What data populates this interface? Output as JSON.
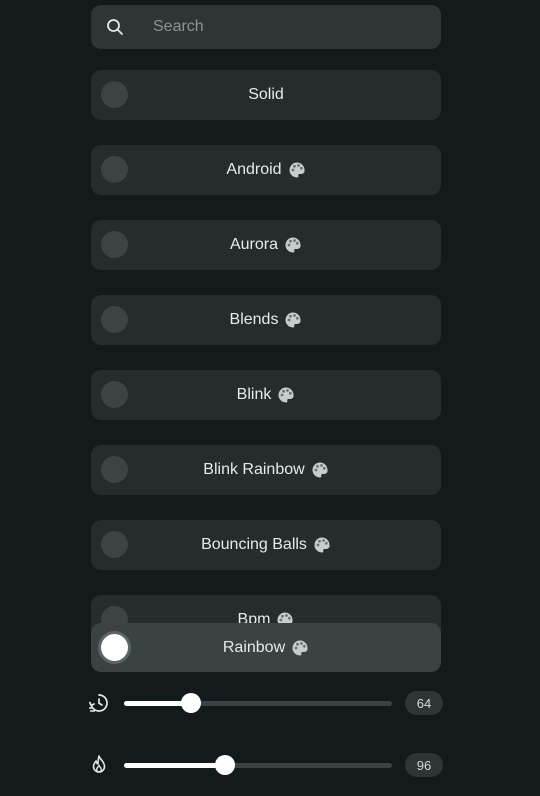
{
  "search": {
    "placeholder": "Search",
    "value": ""
  },
  "effects": [
    {
      "label": "Solid",
      "palette": false
    },
    {
      "label": "Android",
      "palette": true
    },
    {
      "label": "Aurora",
      "palette": true
    },
    {
      "label": "Blends",
      "palette": true
    },
    {
      "label": "Blink",
      "palette": true
    },
    {
      "label": "Blink Rainbow",
      "palette": true
    },
    {
      "label": "Bouncing Balls",
      "palette": true
    },
    {
      "label": "Bpm",
      "palette": true
    }
  ],
  "selected_effect": {
    "label": "Rainbow",
    "palette": true
  },
  "speed": {
    "icon": "speed-history-icon",
    "value": "64",
    "level": 64
  },
  "intensity": {
    "icon": "flame-icon",
    "value": "96",
    "level": 96
  },
  "colors": {
    "background": "#131a1b",
    "item": "#252c2d",
    "selected_item": "#3a4243",
    "accent": "#ffffff"
  }
}
